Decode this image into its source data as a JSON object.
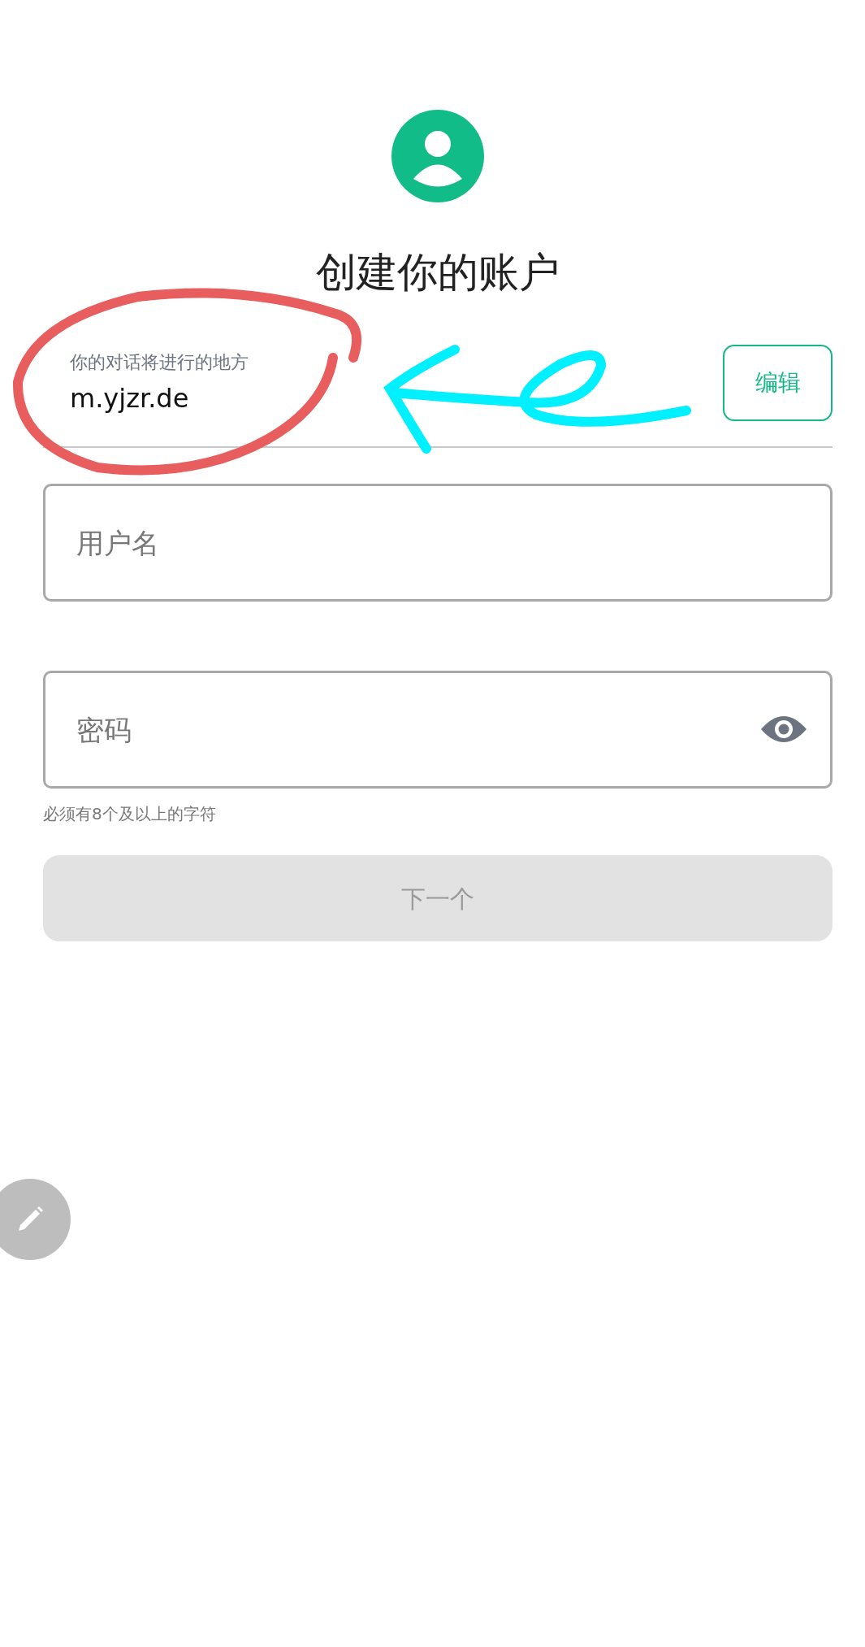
{
  "title": "创建你的账户",
  "server": {
    "label": "你的对话将进行的地方",
    "value": "m.yjzr.de",
    "edit_button": "编辑"
  },
  "username": {
    "placeholder": "用户名"
  },
  "password": {
    "placeholder": "密码",
    "hint": "必须有8个及以上的字符"
  },
  "next_button": {
    "label": "下一个",
    "disabled": true
  },
  "annotations": [
    {
      "kind": "circle",
      "color": "#e85d5d"
    },
    {
      "kind": "arrow",
      "color": "#00f0ff"
    }
  ]
}
